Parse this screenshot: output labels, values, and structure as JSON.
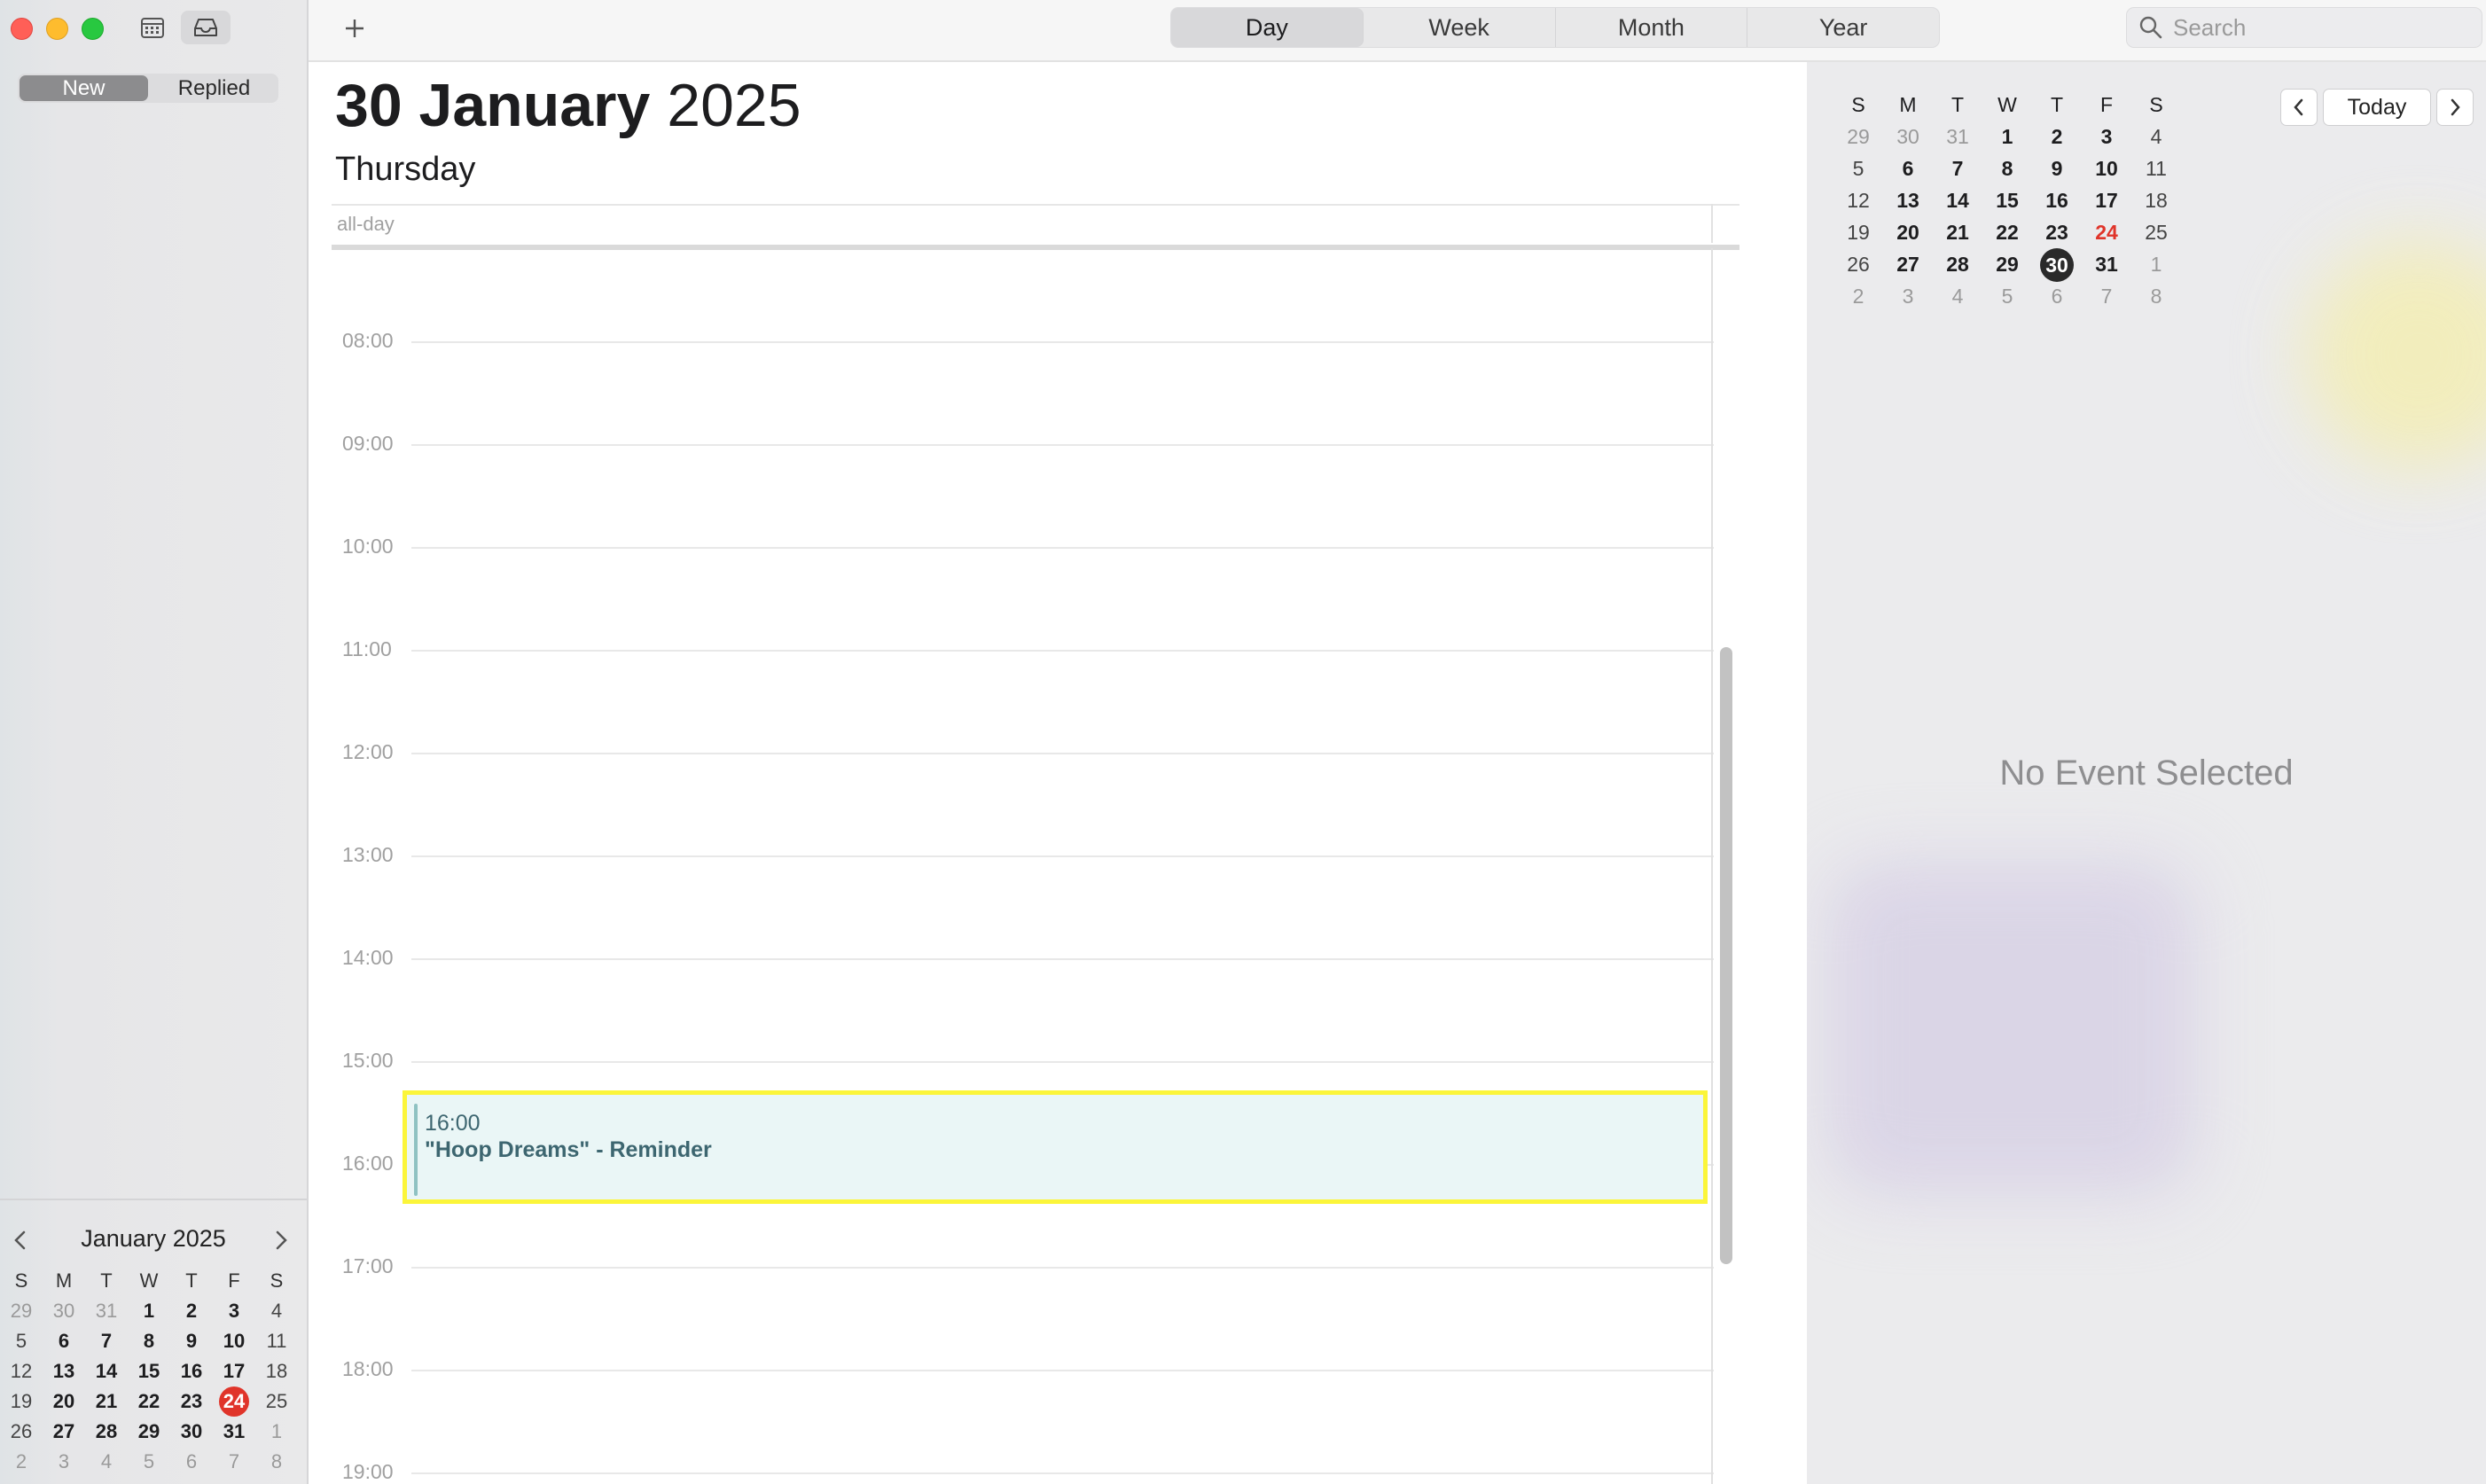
{
  "sidebar": {
    "tabs": [
      {
        "label": "New",
        "active": true
      },
      {
        "label": "Replied",
        "active": false
      }
    ],
    "mini_calendar": {
      "title": "January 2025",
      "weekdays": [
        "S",
        "M",
        "T",
        "W",
        "T",
        "F",
        "S"
      ],
      "days": [
        [
          "29",
          "30",
          "31",
          "1",
          "2",
          "3",
          "4"
        ],
        [
          "5",
          "6",
          "7",
          "8",
          "9",
          "10",
          "11"
        ],
        [
          "12",
          "13",
          "14",
          "15",
          "16",
          "17",
          "18"
        ],
        [
          "19",
          "20",
          "21",
          "22",
          "23",
          "24",
          "25"
        ],
        [
          "26",
          "27",
          "28",
          "29",
          "30",
          "31",
          "1"
        ],
        [
          "2",
          "3",
          "4",
          "5",
          "6",
          "7",
          "8"
        ]
      ],
      "today": "24"
    }
  },
  "toolbar": {
    "add_label": "+",
    "views": [
      {
        "label": "Day",
        "active": true
      },
      {
        "label": "Week",
        "active": false
      },
      {
        "label": "Month",
        "active": false
      },
      {
        "label": "Year",
        "active": false
      }
    ],
    "search_placeholder": "Search"
  },
  "day_view": {
    "date_bold": "30 January",
    "year": "2025",
    "weekday": "Thursday",
    "allday_label": "all-day",
    "hours": [
      "08:00",
      "09:00",
      "10:00",
      "11:00",
      "12:00",
      "13:00",
      "14:00",
      "15:00",
      "16:00",
      "17:00",
      "18:00",
      "19:00"
    ],
    "event": {
      "time": "16:00",
      "title": "\"Hoop Dreams\" - Reminder",
      "color": "#eaf6f6",
      "highlight_color": "#fbf53a"
    }
  },
  "right_panel": {
    "mini_calendar": {
      "weekdays": [
        "S",
        "M",
        "T",
        "W",
        "T",
        "F",
        "S"
      ],
      "days": [
        [
          "29",
          "30",
          "31",
          "1",
          "2",
          "3",
          "4"
        ],
        [
          "5",
          "6",
          "7",
          "8",
          "9",
          "10",
          "11"
        ],
        [
          "12",
          "13",
          "14",
          "15",
          "16",
          "17",
          "18"
        ],
        [
          "19",
          "20",
          "21",
          "22",
          "23",
          "24",
          "25"
        ],
        [
          "26",
          "27",
          "28",
          "29",
          "30",
          "31",
          "1"
        ],
        [
          "2",
          "3",
          "4",
          "5",
          "6",
          "7",
          "8"
        ]
      ],
      "today": "24",
      "selected": "30"
    },
    "today_button": "Today",
    "empty_state": "No Event Selected"
  },
  "colors": {
    "accent_red": "#e0342a",
    "selected_dark": "#2a2a2a"
  }
}
